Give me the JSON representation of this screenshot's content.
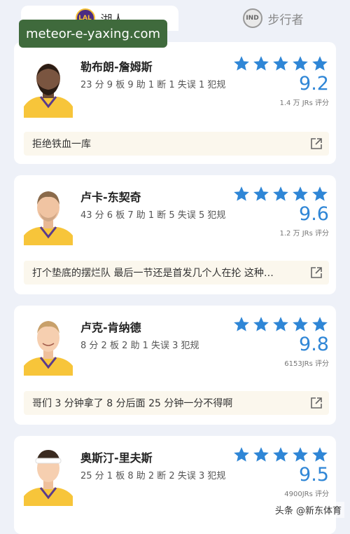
{
  "tabs": {
    "home": {
      "name": "湖人",
      "icon": "lakers-logo-icon"
    },
    "away": {
      "name": "步行者",
      "icon": "pacers-logo-icon"
    }
  },
  "watermark": "meteor-e-yaxing.com",
  "players": [
    {
      "name": "勒布朗-詹姆斯",
      "stats": "23 分 9 板 9 助 1 断 1 失误 1 犯规",
      "rating": 5,
      "score": "9.2",
      "votes": "1.4 万 JRs 评分",
      "comment": "拒绝铁血一库"
    },
    {
      "name": "卢卡-东契奇",
      "stats": "43 分 6 板 7 助 1 断 5 失误 5 犯规",
      "rating": 5,
      "score": "9.6",
      "votes": "1.2 万 JRs 评分",
      "comment": "打个垫底的摆烂队  最后一节还是首发几个人在抡 这种…"
    },
    {
      "name": "卢克-肯纳德",
      "stats": "8 分 2 板 2 助 1 失误 3 犯规",
      "rating": 5,
      "score": "9.8",
      "votes": "6153JRs 评分",
      "comment": "哥们 3 分钟拿了 8 分后面 25 分钟一分不得啊"
    },
    {
      "name": "奥斯汀-里夫斯",
      "stats": "25 分 1 板 8 助 2 断 2 失误 3 犯规",
      "rating": 5,
      "score": "9.5",
      "votes": "4900JRs 评分",
      "comment": ""
    }
  ],
  "credit": "头条 @新东体育",
  "colors": {
    "star": "#2f86d6",
    "score": "#2f86d6",
    "jersey": "#f7c53a"
  }
}
